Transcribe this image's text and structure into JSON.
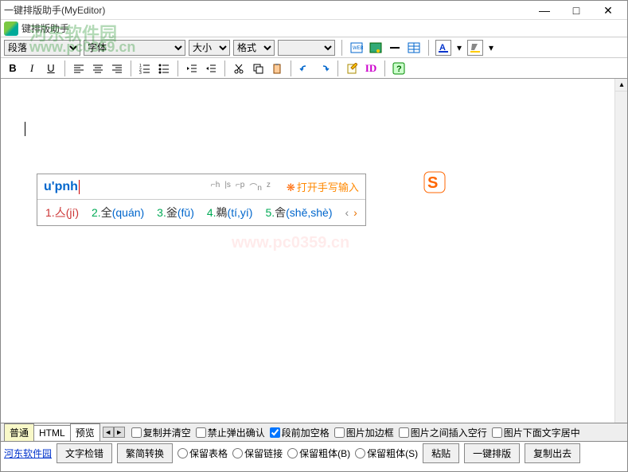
{
  "window": {
    "title": "一键排版助手(MyEditor)",
    "min": "—",
    "max": "□",
    "close": "✕"
  },
  "menubar": {
    "text": "键排版助手"
  },
  "watermark": {
    "brand": "河东软件园",
    "url": "www.pc0359.cn",
    "center": "www.pc0359.cn"
  },
  "toolbar1": {
    "paragraph": "段落",
    "font": "字体",
    "size": "大小",
    "format": "格式"
  },
  "toolbar2": {
    "bold": "B",
    "italic": "I",
    "underline": "U",
    "id": "ID",
    "help": "?"
  },
  "ime": {
    "input": "u'pnh",
    "handwrite": "打开手写输入",
    "tools": [
      "⌐h",
      "|s",
      "⌐p",
      "⌒n",
      "z"
    ],
    "candidates": [
      {
        "n": "1.",
        "ch": "亼",
        "py": "(jí)"
      },
      {
        "n": "2.",
        "ch": "全",
        "py": "(quán)"
      },
      {
        "n": "3.",
        "ch": "釡",
        "py": "(fǔ)"
      },
      {
        "n": "4.",
        "ch": "鵜",
        "py": "(tí,yí)"
      },
      {
        "n": "5.",
        "ch": "舎",
        "py": "(shě,shè)"
      }
    ]
  },
  "tabs": {
    "items": [
      "普通",
      "HTML",
      "预览"
    ],
    "opts": {
      "copy_clear": "复制并清空",
      "no_popup": "禁止弹出确认",
      "para_space": "段前加空格",
      "img_border": "图片加边框",
      "img_blank": "图片之间插入空行",
      "img_center": "图片下面文字居中"
    }
  },
  "bottom": {
    "link": "河东软件园",
    "btn_check": "文字检错",
    "btn_convert": "繁简转换",
    "rb_table": "保留表格",
    "rb_link": "保留链接",
    "rb_bold_b": "保留粗体(B)",
    "rb_bold_s": "保留粗体(S)",
    "btn_paste": "粘贴",
    "btn_format": "一键排版",
    "btn_copyout": "复制出去"
  }
}
